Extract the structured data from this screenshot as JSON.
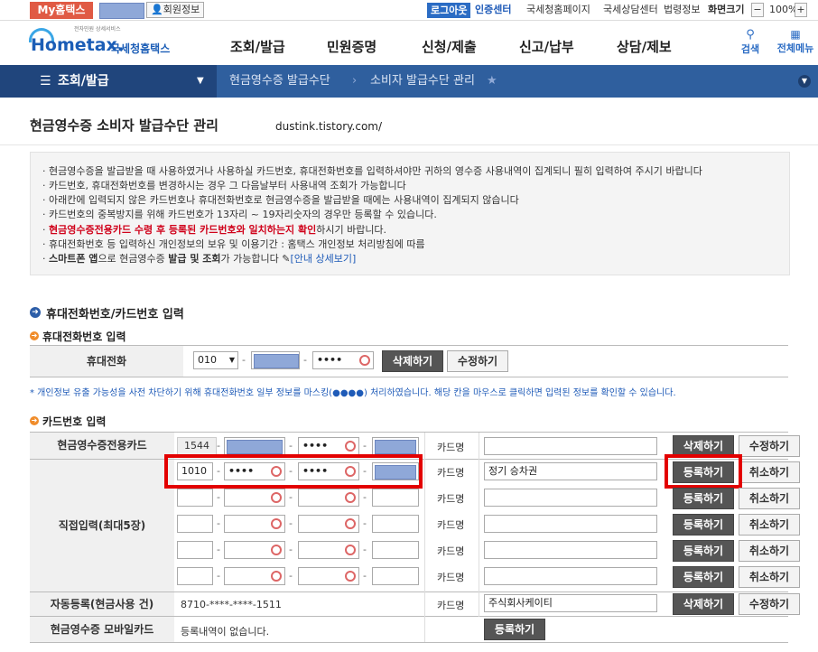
{
  "topbar": {
    "myhometax": "My홈택스",
    "member_info": "회원정보",
    "logout": "로그아웃",
    "cert_center": "인증센터",
    "links": [
      "국세청홈페이지",
      "국세상담센터",
      "법령정보",
      "화면크기"
    ],
    "zoom": "100%",
    "zoom_minus": "−",
    "zoom_plus": "+"
  },
  "header": {
    "logo_small": "전자민원 상세서비스",
    "logo_main": "Hometax.",
    "logo_sub": "국세청홈택스",
    "menu": [
      "조회/발급",
      "민원증명",
      "신청/제출",
      "신고/납부",
      "상담/제보"
    ],
    "search": "검색",
    "all_menu": "전체메뉴"
  },
  "nav": {
    "section": "조회/발급",
    "crumb1": "현금영수증 발급수단",
    "crumb2": "소비자 발급수단 관리"
  },
  "page": {
    "title": "현금영수증 소비자 발급수단 관리",
    "watermark": "dustink.tistory.com/"
  },
  "notice": [
    {
      "text": "현금영수증을 발급받을 때 사용하였거나 사용하실 카드번호, 휴대전화번호를 입력하셔야만 귀하의 영수증 사용내역이 집계되니 필히 입력하여 주시기 바랍니다"
    },
    {
      "text": "카드번호, 휴대전화번호를 변경하시는 경우 그 다음날부터 사용내역 조회가 가능합니다"
    },
    {
      "text": "아래칸에 입력되지 않은 카드번호나 휴대전화번호로 현금영수증을 발급받을 때에는 사용내역이 집계되지 않습니다"
    },
    {
      "text": "카드번호의 중복방지를 위해 카드번호가 13자리 ~ 19자리숫자의 경우만 등록할 수 있습니다."
    },
    {
      "red": "현금영수증전용카드 수령 후 등록된 카드번호와 일치하는지 확인",
      "text": "하시기 바랍니다."
    },
    {
      "text": "휴대전화번호 등 입력하신 개인정보의 보유 및 이용기간 : 홈택스 개인정보 처리방침에 따름"
    },
    {
      "bold1": "스마트폰 앱",
      "t1": "으로 현금영수증 ",
      "bold2": "발급 및 조회",
      "t2": "가 가능합니다 ",
      "link": "[안내 상세보기]"
    }
  ],
  "section_input": "휴대전화번호/카드번호 입력",
  "phone": {
    "heading": "휴대전화번호 입력",
    "label": "휴대전화",
    "prefix": "010",
    "masked_mid": "••••",
    "delete": "삭제하기",
    "edit": "수정하기"
  },
  "privacy_note": "* 개인정보 유출 가능성을 사전 차단하기 위해 휴대전화번호 일부 정보를 마스킹(●●●●) 처리하였습니다. 해당 칸을 마우스로 클릭하면 입력된 정보를 확인할 수 있습니다.",
  "card": {
    "heading": "카드번호 입력",
    "card_name_label": "카드명",
    "rows": [
      {
        "label": "현금영수증전용카드",
        "p1": "1544",
        "p2": "",
        "p3": "••••",
        "p4": "",
        "name": "",
        "btn1": "삭제하기",
        "btn2": "수정하기"
      },
      {
        "label": "",
        "p1": "1010",
        "p2": "••••",
        "p3": "••••",
        "p4": "",
        "name": "정기 승차권",
        "btn1": "등록하기",
        "btn2": "취소하기"
      },
      {
        "label": "",
        "p1": "",
        "p2": "",
        "p3": "",
        "p4": "",
        "name": "",
        "btn1": "등록하기",
        "btn2": "취소하기"
      },
      {
        "label": "직접입력(최대5장)",
        "p1": "",
        "p2": "",
        "p3": "",
        "p4": "",
        "name": "",
        "btn1": "등록하기",
        "btn2": "취소하기"
      },
      {
        "label": "",
        "p1": "",
        "p2": "",
        "p3": "",
        "p4": "",
        "name": "",
        "btn1": "등록하기",
        "btn2": "취소하기"
      },
      {
        "label": "",
        "p1": "",
        "p2": "",
        "p3": "",
        "p4": "",
        "name": "",
        "btn1": "등록하기",
        "btn2": "취소하기"
      }
    ],
    "auto": {
      "label": "자동등록(현금사용 건)",
      "number": "8710-****-****-1511",
      "name": "주식회사케이티",
      "btn1": "삭제하기",
      "btn2": "수정하기"
    },
    "mobile": {
      "label": "현금영수증 모바일카드",
      "text": "등록내역이 없습니다.",
      "btn": "등록하기"
    }
  }
}
